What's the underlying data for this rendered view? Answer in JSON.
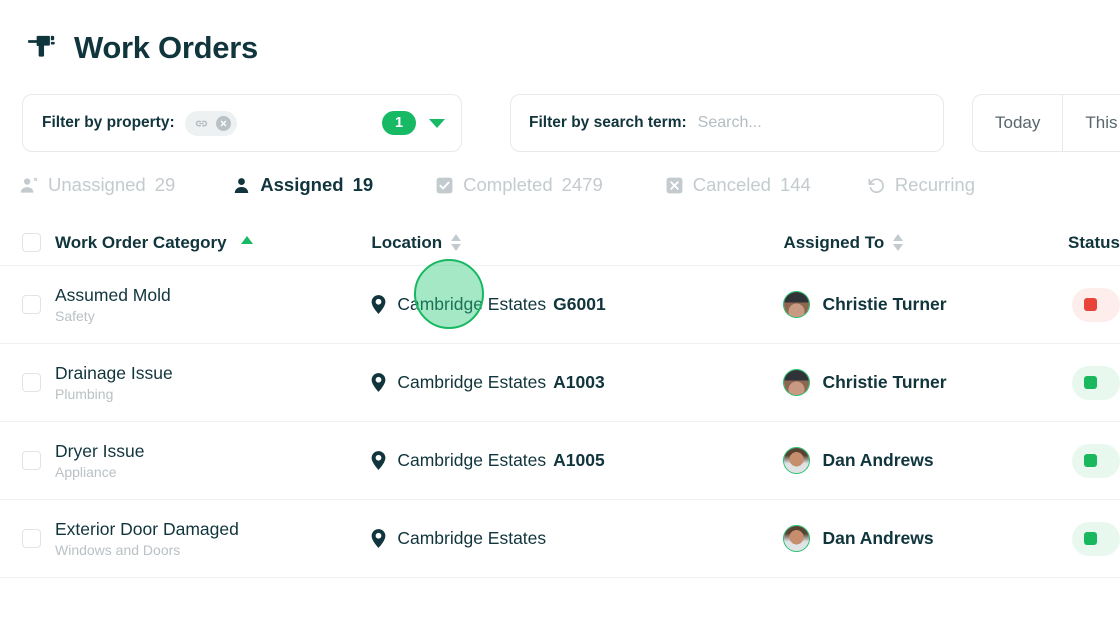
{
  "header": {
    "title": "Work Orders",
    "icon": "drill-icon"
  },
  "filters": {
    "property": {
      "label": "Filter by property:",
      "chip_icon": "link-icon",
      "chip_close_icon": "close-icon",
      "count": "1",
      "dropdown_icon": "chevron-down-icon",
      "accent_color": "#17b964"
    },
    "search": {
      "label": "Filter by search term:",
      "value": "",
      "placeholder": "Search..."
    },
    "date_range": {
      "options": [
        "Today",
        "This Week"
      ]
    }
  },
  "tabs": [
    {
      "label": "Unassigned",
      "count": "29",
      "icon": "user-x-icon",
      "active": false
    },
    {
      "label": "Assigned",
      "count": "19",
      "icon": "user-icon",
      "active": true
    },
    {
      "label": "Completed",
      "count": "2479",
      "icon": "check-box-icon",
      "active": false
    },
    {
      "label": "Canceled",
      "count": "144",
      "icon": "x-box-icon",
      "active": false
    },
    {
      "label": "Recurring",
      "count": "",
      "icon": "refresh-icon",
      "active": false
    }
  ],
  "table": {
    "columns": [
      {
        "label": "Work Order Category",
        "sort": "asc"
      },
      {
        "label": "Location",
        "sort": "none"
      },
      {
        "label": "Assigned To",
        "sort": "none"
      },
      {
        "label": "Status",
        "sort": "none"
      }
    ],
    "rows": [
      {
        "category": "Assumed Mold",
        "subcategory": "Safety",
        "location_property": "Cambridge Estates",
        "location_unit": "G6001",
        "assignee": "Christie Turner",
        "status_color": "#e8443a",
        "status_bg": "#fdeeec"
      },
      {
        "category": "Drainage Issue",
        "subcategory": "Plumbing",
        "location_property": "Cambridge Estates",
        "location_unit": "A1003",
        "assignee": "Christie Turner",
        "status_color": "#19b85f",
        "status_bg": "#e9f8ef"
      },
      {
        "category": "Dryer Issue",
        "subcategory": "Appliance",
        "location_property": "Cambridge Estates",
        "location_unit": "A1005",
        "assignee": "Dan Andrews",
        "status_color": "#19b85f",
        "status_bg": "#e9f8ef"
      },
      {
        "category": "Exterior Door Damaged",
        "subcategory": "Windows and Doors",
        "location_property": "Cambridge Estates",
        "location_unit": "",
        "assignee": "Dan Andrews",
        "status_color": "#19b85f",
        "status_bg": "#e9f8ef"
      }
    ]
  },
  "cursor_highlight": {
    "target": "Location",
    "color": "#18b862"
  }
}
